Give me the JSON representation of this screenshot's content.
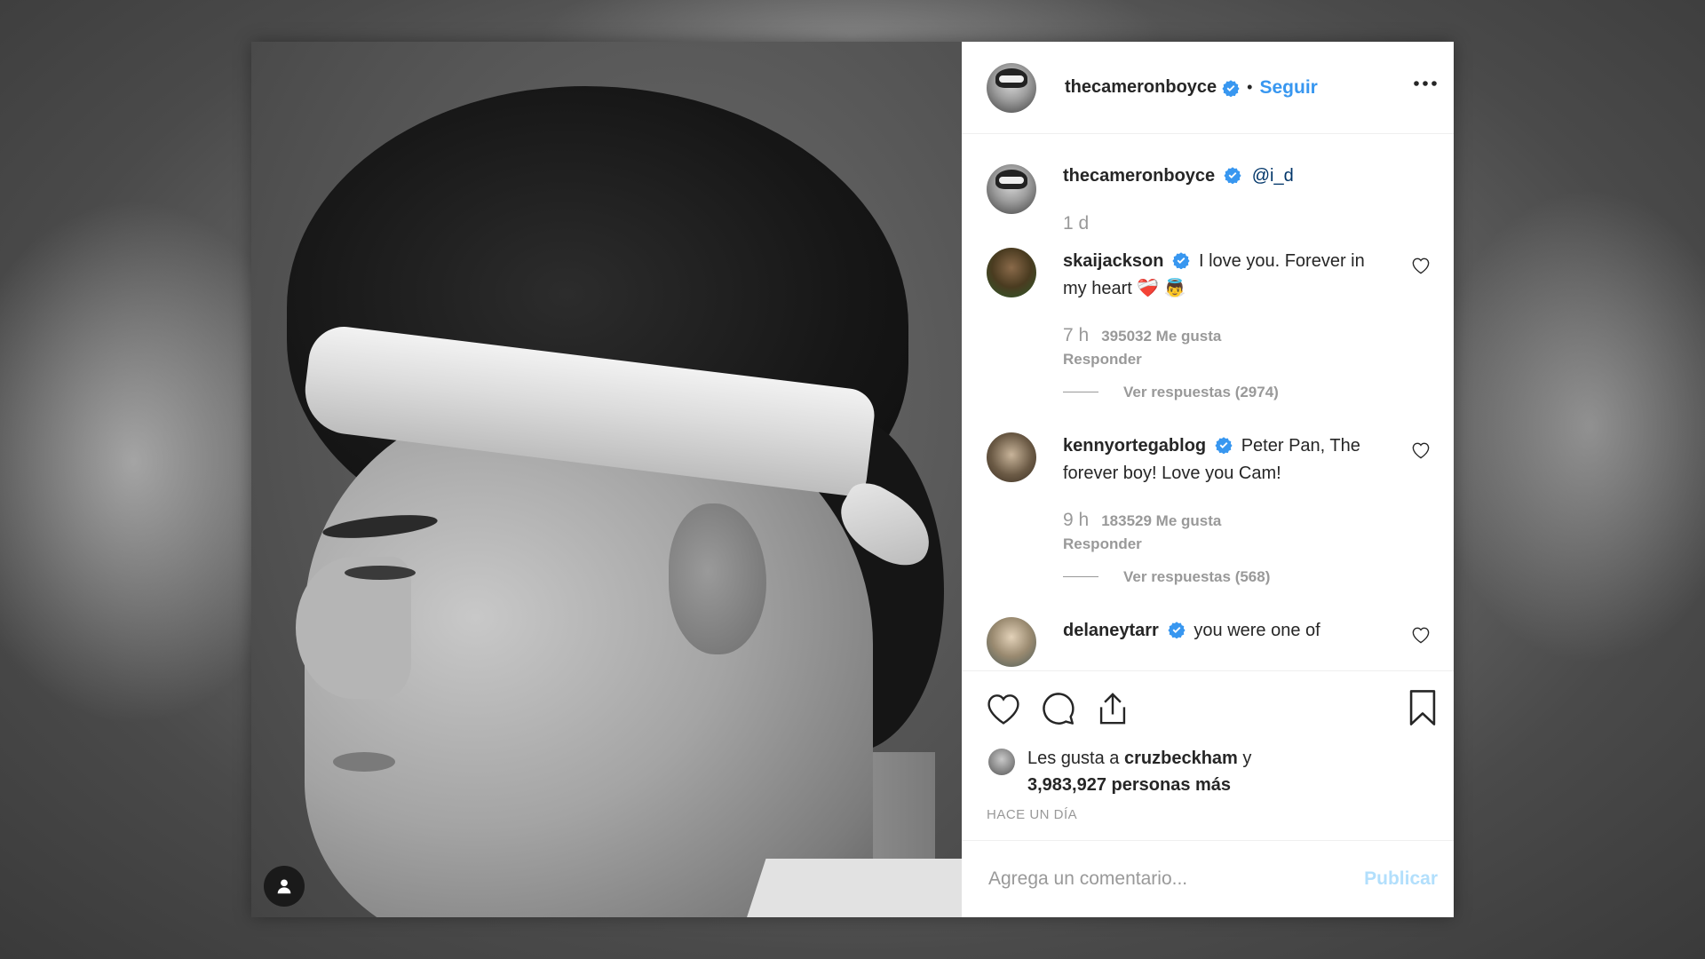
{
  "post": {
    "author": "thecameronboyce",
    "follow_label": "Seguir",
    "separator": "•"
  },
  "caption": {
    "username": "thecameronboyce",
    "text": "@i_d",
    "time": "1 d"
  },
  "comments": [
    {
      "username": "skaijackson",
      "text": "I love you. Forever in my heart ❤️‍🩹 👼",
      "time": "7 h",
      "likes": "395032 Me gusta",
      "reply": "Responder",
      "view_replies": "Ver respuestas (2974)"
    },
    {
      "username": "kennyortegablog",
      "text": "Peter Pan, The forever boy! Love you Cam!",
      "time": "9 h",
      "likes": "183529 Me gusta",
      "reply": "Responder",
      "view_replies": "Ver respuestas (568)"
    },
    {
      "username": "delaneytarr",
      "text": "you were one of"
    }
  ],
  "likes_summary": {
    "prefix": "Les gusta a",
    "user": "cruzbeckham",
    "conj": "y",
    "count": "3,983,927 personas más"
  },
  "time_ago": "HACE UN DÍA",
  "comment_box": {
    "placeholder": "Agrega un comentario...",
    "publish": "Publicar"
  },
  "colors": {
    "accent": "#3897f0",
    "verified": "#3897f0",
    "publish_disabled": "#b2dffc"
  },
  "icons": {
    "like": "heart-icon",
    "comment": "comment-icon",
    "share": "share-icon",
    "save": "bookmark-icon",
    "more": "more-options-icon",
    "tag": "user-tag-icon"
  }
}
